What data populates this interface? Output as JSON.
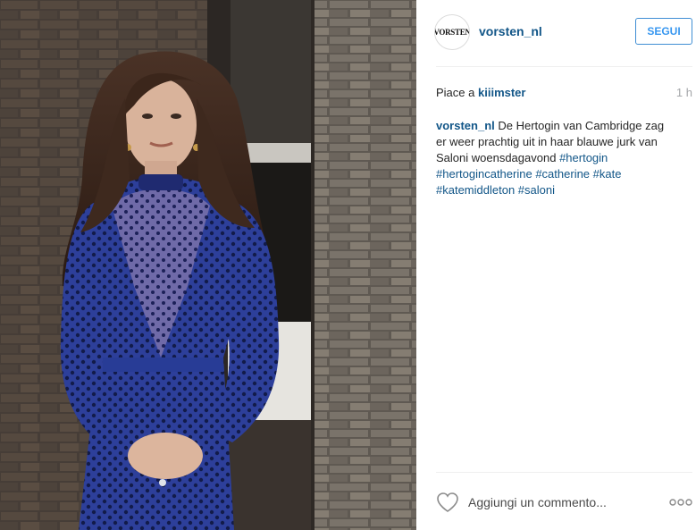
{
  "post": {
    "image_alt": "Woman in blue polka dot dress standing in front of brick wall",
    "username": "vorsten_nl",
    "avatar_text": "VORSTEN",
    "follow_label": "SEGUI",
    "likes_prefix": "Piace a",
    "liked_by": "kiiimster",
    "time": "1 h",
    "caption": {
      "author": "vorsten_nl",
      "line1_text": "De Hertogin van Cambridge zag",
      "line2_text": "er weer prachtig uit in haar blauwe jurk van",
      "line3_text": "Saloni woensdagavond",
      "tags": [
        "#hertogin",
        "#hertogincatherine",
        "#catherine",
        "#kate",
        "#katemiddleton",
        "#saloni"
      ]
    },
    "comment_placeholder": "Aggiungi un commento...",
    "icons": {
      "heart": "heart-icon",
      "more": "more-options-icon"
    }
  },
  "colors": {
    "link": "#125688",
    "follow_border": "#3f8ed4",
    "follow_text": "#3897f0",
    "muted": "#a5a7aa",
    "dress_blue": "#2b3f9c"
  }
}
